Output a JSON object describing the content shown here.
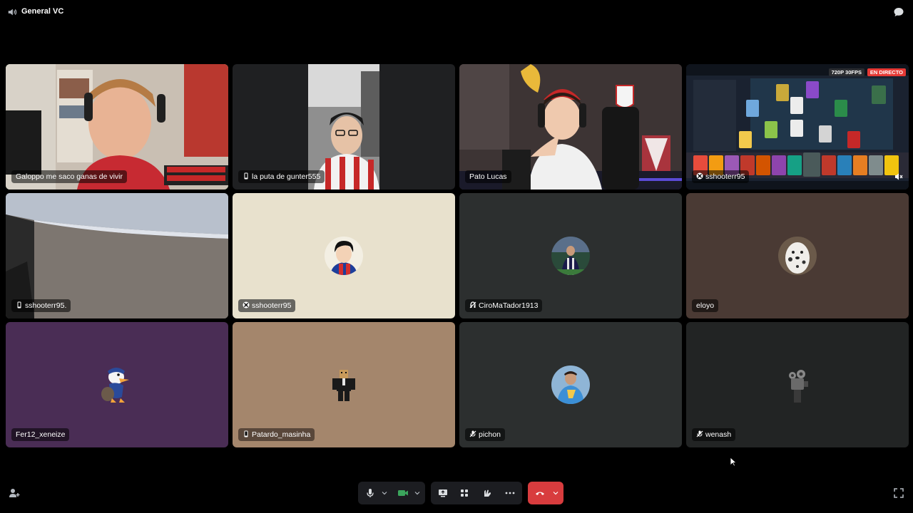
{
  "window": {
    "title": "General VC"
  },
  "tiles": [
    {
      "name": "Galoppo me saco ganas de vivir",
      "icon": ""
    },
    {
      "name": "la puta de gunter555",
      "icon": "phone-icon"
    },
    {
      "name": "Pato Lucas",
      "icon": ""
    },
    {
      "name": "sshooterr95",
      "icon": "xbox-icon"
    },
    {
      "name": "sshooterr95.",
      "icon": "phone-icon"
    },
    {
      "name": "sshooterr95",
      "icon": "xbox-icon"
    },
    {
      "name": "CiroMaTador1913",
      "icon": "deafened-icon"
    },
    {
      "name": "eloyo",
      "icon": ""
    },
    {
      "name": "Fer12_xeneize",
      "icon": ""
    },
    {
      "name": "Patardo_masinha",
      "icon": "phone-icon"
    },
    {
      "name": "pichon",
      "icon": "muted-icon"
    },
    {
      "name": "wenash",
      "icon": "muted-icon"
    }
  ],
  "stream": {
    "quality": "720P 30FPS",
    "live": "EN DIRECTO"
  },
  "colors": {
    "background": "#000000",
    "speaking_ring": "#3ba55c",
    "hangup": "#d83c3e",
    "live_badge": "#e53935",
    "tile_cream": "#e8e1cd",
    "tile_dark": "#2c2f2f",
    "tile_brown": "#4a3a34",
    "tile_purple": "#4a2d55",
    "tile_tan": "#a4866c"
  },
  "controls": {
    "items": [
      "microphone-icon",
      "chevron-down-icon",
      "camera-icon",
      "chevron-down-icon",
      "screen-share-icon",
      "activities-icon",
      "soundboard-icon",
      "more-icon",
      "hangup-icon",
      "chevron-down-icon"
    ]
  }
}
